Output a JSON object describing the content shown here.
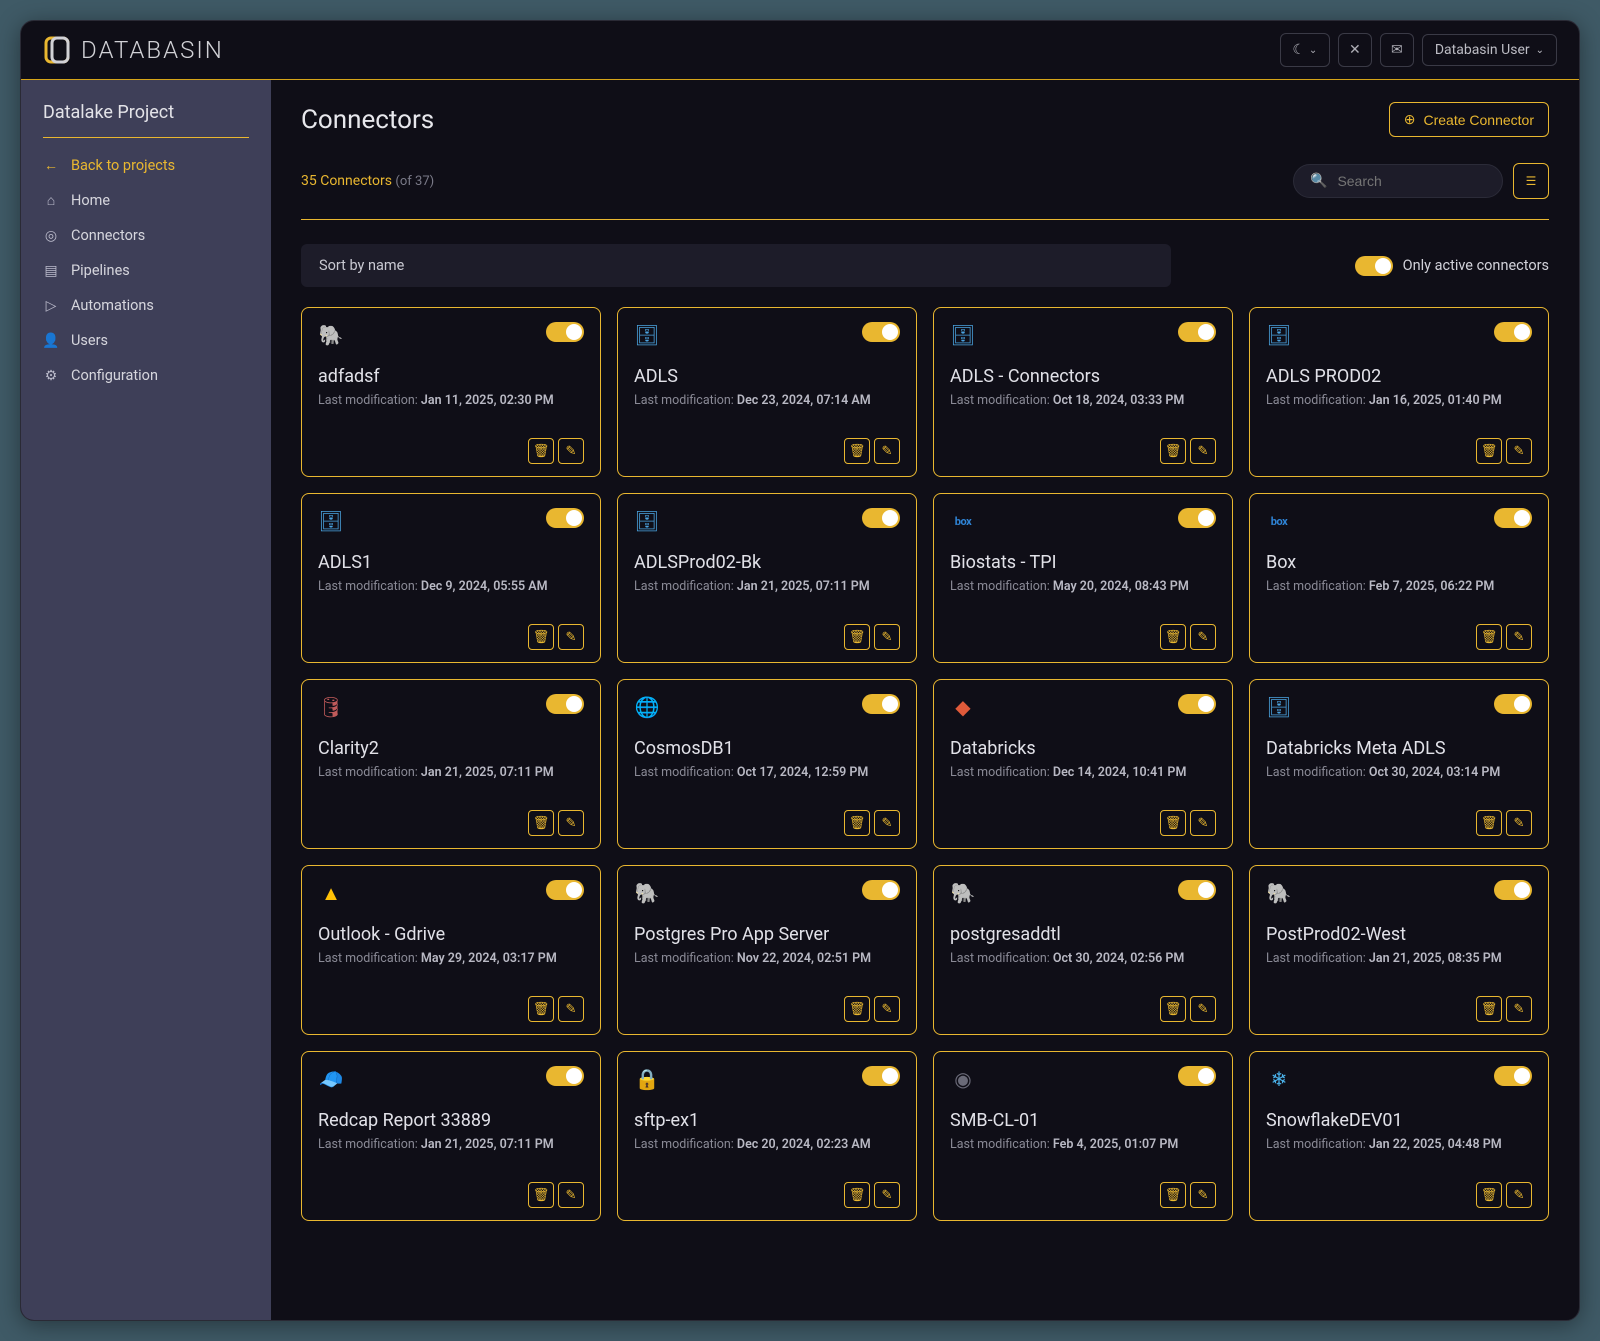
{
  "app": {
    "brand": "DATABASIN"
  },
  "topbar": {
    "user_label": "Databasin User"
  },
  "sidebar": {
    "title": "Datalake Project",
    "back_label": "Back to projects",
    "items": [
      {
        "label": "Home",
        "icon": "home"
      },
      {
        "label": "Connectors",
        "icon": "target"
      },
      {
        "label": "Pipelines",
        "icon": "stack"
      },
      {
        "label": "Automations",
        "icon": "play"
      },
      {
        "label": "Users",
        "icon": "user"
      },
      {
        "label": "Configuration",
        "icon": "gear"
      }
    ]
  },
  "page": {
    "title": "Connectors",
    "create_label": "Create Connector",
    "count_label": "35 Connectors",
    "count_of": "(of 37)",
    "search_placeholder": "Search",
    "sort_label": "Sort by name",
    "active_toggle_label": "Only active connectors",
    "mod_prefix": "Last modification: "
  },
  "connectors": [
    {
      "name": "adfadsf",
      "mod": "Jan 11, 2025, 02:30 PM",
      "icon": "pg"
    },
    {
      "name": "ADLS",
      "mod": "Dec 23, 2024, 07:14 AM",
      "icon": "adls"
    },
    {
      "name": "ADLS - Connectors",
      "mod": "Oct 18, 2024, 03:33 PM",
      "icon": "adls"
    },
    {
      "name": "ADLS PROD02",
      "mod": "Jan 16, 2025, 01:40 PM",
      "icon": "adls"
    },
    {
      "name": "ADLS1",
      "mod": "Dec 9, 2024, 05:55 AM",
      "icon": "adls"
    },
    {
      "name": "ADLSProd02-Bk",
      "mod": "Jan 21, 2025, 07:11 PM",
      "icon": "adls"
    },
    {
      "name": "Biostats - TPI",
      "mod": "May 20, 2024, 08:43 PM",
      "icon": "box"
    },
    {
      "name": "Box",
      "mod": "Feb 7, 2025, 06:22 PM",
      "icon": "box"
    },
    {
      "name": "Clarity2",
      "mod": "Jan 21, 2025, 07:11 PM",
      "icon": "sql"
    },
    {
      "name": "CosmosDB1",
      "mod": "Oct 17, 2024, 12:59 PM",
      "icon": "cosmos"
    },
    {
      "name": "Databricks",
      "mod": "Dec 14, 2024, 10:41 PM",
      "icon": "databricks"
    },
    {
      "name": "Databricks Meta ADLS",
      "mod": "Oct 30, 2024, 03:14 PM",
      "icon": "adls"
    },
    {
      "name": "Outlook - Gdrive",
      "mod": "May 29, 2024, 03:17 PM",
      "icon": "gdrive"
    },
    {
      "name": "Postgres Pro App Server",
      "mod": "Nov 22, 2024, 02:51 PM",
      "icon": "pg"
    },
    {
      "name": "postgresaddtl",
      "mod": "Oct 30, 2024, 02:56 PM",
      "icon": "pg"
    },
    {
      "name": "PostProd02-West",
      "mod": "Jan 21, 2025, 08:35 PM",
      "icon": "pg"
    },
    {
      "name": "Redcap Report 33889",
      "mod": "Jan 21, 2025, 07:11 PM",
      "icon": "redcap"
    },
    {
      "name": "sftp-ex1",
      "mod": "Dec 20, 2024, 02:23 AM",
      "icon": "sftp"
    },
    {
      "name": "SMB-CL-01",
      "mod": "Feb 4, 2025, 01:07 PM",
      "icon": "smb"
    },
    {
      "name": "SnowflakeDEV01",
      "mod": "Jan 22, 2025, 04:48 PM",
      "icon": "snowflake"
    }
  ],
  "icon_glyphs": {
    "pg": "🐘",
    "adls": "🗄",
    "box": "box",
    "sql": "🛢",
    "cosmos": "🌐",
    "databricks": "◆",
    "gdrive": "▲",
    "redcap": "🧢",
    "sftp": "🔒",
    "smb": "◉",
    "snowflake": "❄"
  }
}
